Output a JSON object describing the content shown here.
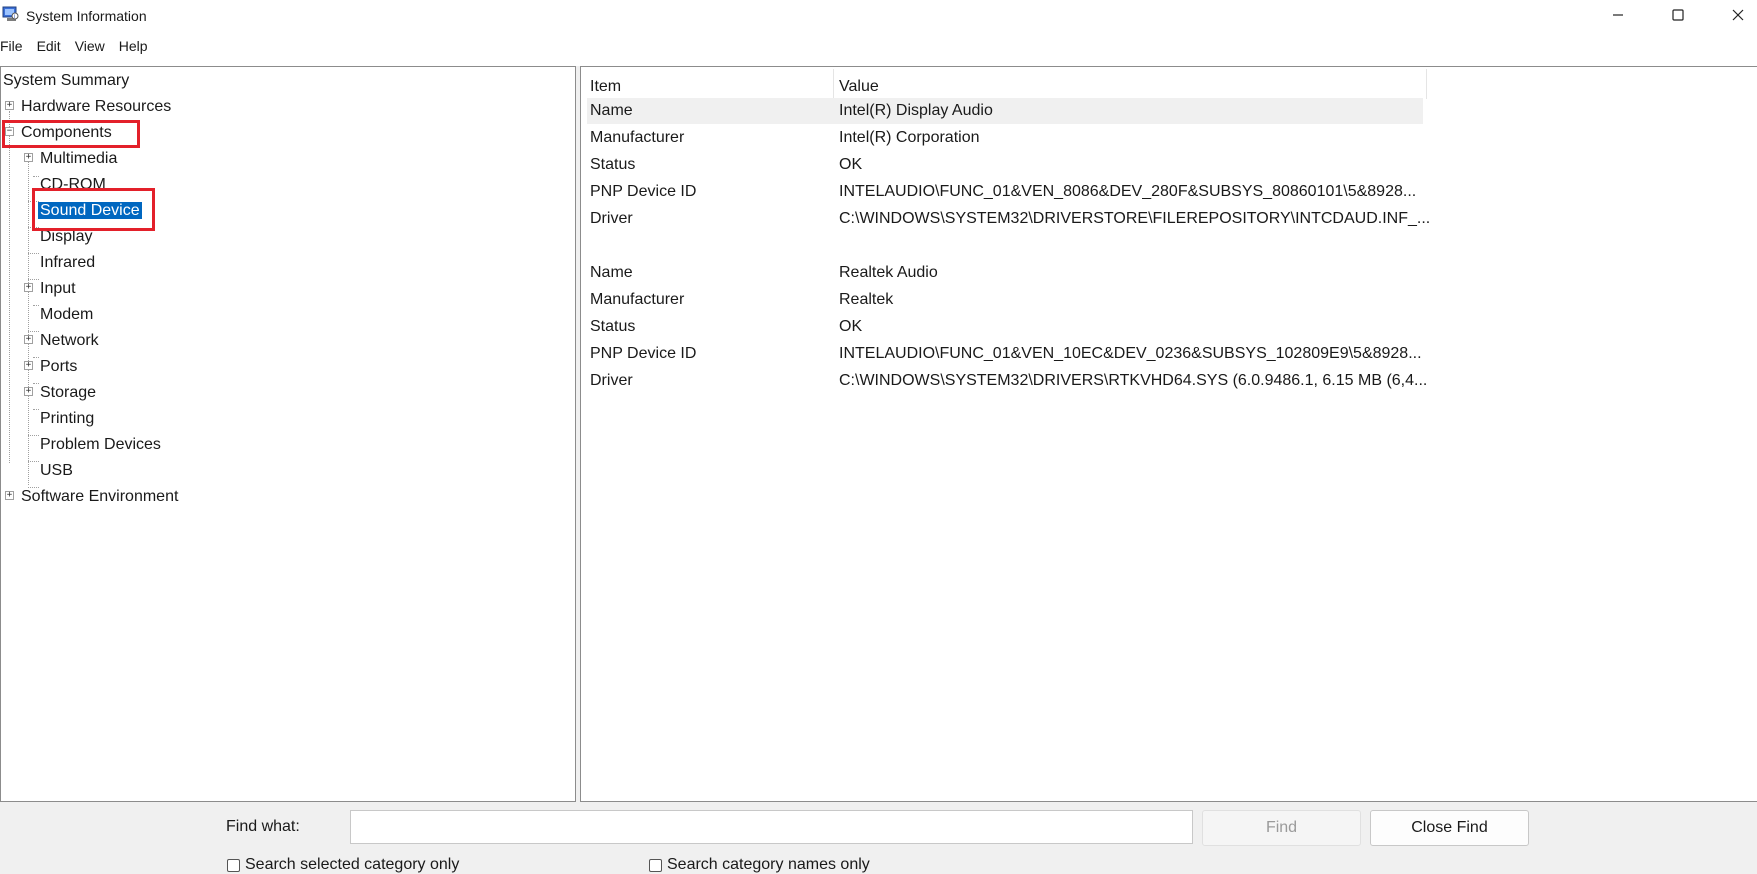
{
  "window": {
    "title": "System Information",
    "icon": "system-info-icon",
    "controls": {
      "minimize": "minimize-icon",
      "maximize": "maximize-icon",
      "close": "close-icon"
    }
  },
  "menu": [
    "File",
    "Edit",
    "View",
    "Help"
  ],
  "tree": {
    "system_summary": "System Summary",
    "hardware_resources": "Hardware Resources",
    "components": "Components",
    "multimedia": "Multimedia",
    "cd_rom": "CD-ROM",
    "sound_device": "Sound Device",
    "display": "Display",
    "infrared": "Infrared",
    "input": "Input",
    "modem": "Modem",
    "network": "Network",
    "ports": "Ports",
    "storage": "Storage",
    "printing": "Printing",
    "problem_devices": "Problem Devices",
    "usb": "USB",
    "software_environment": "Software Environment",
    "selected": "Sound Device",
    "highlight_color": "#e3202a",
    "selection_color": "#0067c0"
  },
  "table": {
    "headers": {
      "item": "Item",
      "value": "Value"
    },
    "rows": [
      {
        "item": "Name",
        "value": "Intel(R) Display Audio"
      },
      {
        "item": "Manufacturer",
        "value": "Intel(R) Corporation"
      },
      {
        "item": "Status",
        "value": "OK"
      },
      {
        "item": "PNP Device ID",
        "value": "INTELAUDIO\\FUNC_01&VEN_8086&DEV_280F&SUBSYS_80860101\\5&8928..."
      },
      {
        "item": "Driver",
        "value": "C:\\WINDOWS\\SYSTEM32\\DRIVERSTORE\\FILEREPOSITORY\\INTCDAUD.INF_..."
      },
      {
        "item": "",
        "value": ""
      },
      {
        "item": "Name",
        "value": "Realtek Audio"
      },
      {
        "item": "Manufacturer",
        "value": "Realtek"
      },
      {
        "item": "Status",
        "value": "OK"
      },
      {
        "item": "PNP Device ID",
        "value": "INTELAUDIO\\FUNC_01&VEN_10EC&DEV_0236&SUBSYS_102809E9\\5&8928..."
      },
      {
        "item": "Driver",
        "value": "C:\\WINDOWS\\SYSTEM32\\DRIVERS\\RTKVHD64.SYS (6.0.9486.1, 6.15 MB (6,4..."
      }
    ]
  },
  "find": {
    "label": "Find what:",
    "value": "",
    "find_button": "Find",
    "close_button": "Close Find",
    "option_selected_category": "Search selected category only",
    "option_category_names": "Search category names only"
  }
}
